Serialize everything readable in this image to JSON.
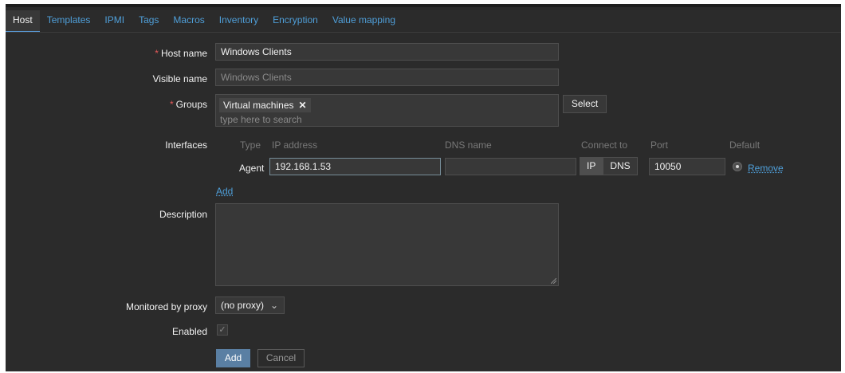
{
  "tabs": [
    "Host",
    "Templates",
    "IPMI",
    "Tags",
    "Macros",
    "Inventory",
    "Encryption",
    "Value mapping"
  ],
  "form": {
    "host_name": {
      "label": "Host name",
      "required_mark": "*",
      "value": "Windows Clients"
    },
    "visible_name": {
      "label": "Visible name",
      "placeholder": "Windows Clients"
    },
    "groups": {
      "label": "Groups",
      "required_mark": "*",
      "chip": "Virtual machines",
      "chip_remove": "✕",
      "search_placeholder": "type here to search",
      "select_button": "Select"
    },
    "interfaces": {
      "label": "Interfaces",
      "columns": {
        "type": "Type",
        "ip": "IP address",
        "dns": "DNS name",
        "connect_to": "Connect to",
        "port": "Port",
        "default": "Default"
      },
      "row": {
        "type": "Agent",
        "ip": "192.168.1.53",
        "dns": "",
        "connect_ip": "IP",
        "connect_dns": "DNS",
        "port": "10050",
        "remove": "Remove"
      },
      "add_link": "Add"
    },
    "description": {
      "label": "Description",
      "value": ""
    },
    "proxy": {
      "label": "Monitored by proxy",
      "value": "(no proxy)"
    },
    "enabled": {
      "label": "Enabled",
      "checked": true
    },
    "buttons": {
      "add": "Add",
      "cancel": "Cancel"
    }
  },
  "colors": {
    "background": "#2b2b2b",
    "accent": "#4f9fd9",
    "primary_button": "#5a7fa3",
    "required": "#e45959"
  }
}
